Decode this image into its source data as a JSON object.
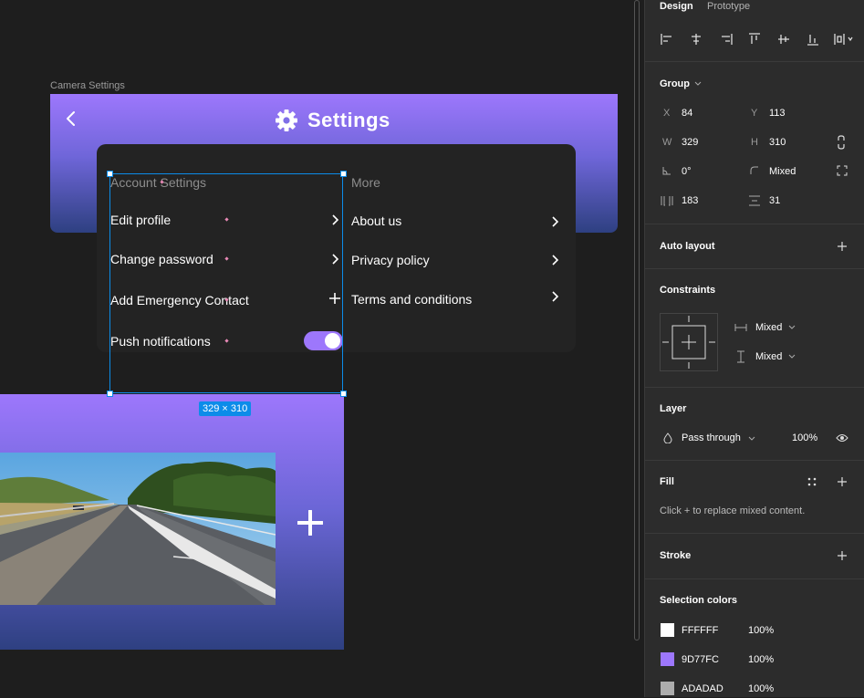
{
  "canvas": {
    "frame_label": "Camera Settings",
    "header_title": "Settings",
    "account_column": {
      "heading": "Account Settings",
      "items": [
        "Edit profile",
        "Change password",
        "Add Emergency Contact",
        "Push notifications"
      ]
    },
    "more_column": {
      "heading": "More",
      "items": [
        "About us",
        "Privacy policy",
        "Terms and conditions"
      ]
    },
    "push_toggle_on": true,
    "selection_size": "329 × 310"
  },
  "panel": {
    "tabs": [
      "Design",
      "Prototype"
    ],
    "group": {
      "title": "Group",
      "x_label": "X",
      "x": "84",
      "y_label": "Y",
      "y": "113",
      "w_label": "W",
      "w": "329",
      "h_label": "H",
      "h": "310",
      "rotation": "0°",
      "radius": "Mixed",
      "spacing_h": "183",
      "spacing_v": "31"
    },
    "auto_layout": "Auto layout",
    "constraints": {
      "title": "Constraints",
      "horizontal": "Mixed",
      "vertical": "Mixed"
    },
    "layer": {
      "title": "Layer",
      "blend": "Pass through",
      "opacity": "100%"
    },
    "fill": {
      "title": "Fill",
      "hint": "Click + to replace mixed content."
    },
    "stroke": "Stroke",
    "selection_colors": {
      "title": "Selection colors",
      "items": [
        {
          "hex": "FFFFFF",
          "opacity": "100%",
          "color": "#FFFFFF"
        },
        {
          "hex": "9D77FC",
          "opacity": "100%",
          "color": "#9D77FC"
        },
        {
          "hex": "ADADAD",
          "opacity": "100%",
          "color": "#ADADAD"
        }
      ]
    }
  },
  "colors": {
    "accent": "#9D77FC",
    "selection_blue": "#0C8CE9",
    "canvas_bg": "#1E1E1E",
    "panel_bg": "#2C2C2C"
  }
}
